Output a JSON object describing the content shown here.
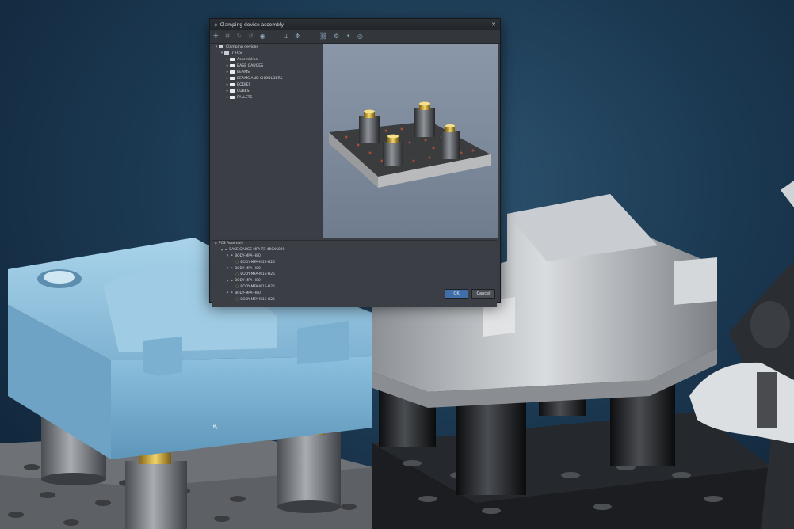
{
  "colors": {
    "background_dark": "#0f2236",
    "cad_part": "#8fc1dc",
    "metal": "#b9bcc0",
    "dialog_bg": "#3a3e44",
    "ok_button": "#3f6ea8"
  },
  "dialog": {
    "title": "Clamping device assembly",
    "close_glyph": "✕",
    "toolbar": [
      {
        "name": "add-icon",
        "glyph": "✚"
      },
      {
        "name": "delete-icon",
        "glyph": "✖"
      },
      {
        "name": "rotate-icon",
        "glyph": "↻"
      },
      {
        "name": "undo-icon",
        "glyph": "↺"
      },
      {
        "name": "view-icon",
        "glyph": "◉"
      },
      {
        "name": "pin-icon",
        "glyph": "⟂"
      },
      {
        "name": "move-icon",
        "glyph": "✥"
      },
      {
        "name": "link-icon",
        "glyph": "⛓"
      },
      {
        "name": "gear-icon",
        "glyph": "⚙"
      },
      {
        "name": "wand-icon",
        "glyph": "✦"
      },
      {
        "name": "eye-icon",
        "glyph": "◎"
      }
    ],
    "tree": {
      "root": "Clamping devices",
      "items": [
        {
          "label": "7 FCS",
          "level": 1,
          "expanded": true
        },
        {
          "label": "Assemblies",
          "level": 2
        },
        {
          "label": "BASE GAUGES",
          "level": 2
        },
        {
          "label": "BEAMS",
          "level": 2
        },
        {
          "label": "BEAMS AND SHOULDERS",
          "level": 2
        },
        {
          "label": "BODIES",
          "level": 2
        },
        {
          "label": "CUBES",
          "level": 2
        },
        {
          "label": "PALLETS",
          "level": 2
        }
      ]
    },
    "assembly_tree": {
      "root": "FCS Assembly",
      "items": [
        {
          "label": "BASE GAUGE MFA TR 400X600S",
          "level": 1,
          "type": "asm"
        },
        {
          "label": "BODY-MFA-H80",
          "level": 2,
          "type": "asm"
        },
        {
          "label": "BODY-MFA-M16-H25",
          "level": 3,
          "type": "part"
        },
        {
          "label": "BODY-MFA-H80",
          "level": 2,
          "type": "asm"
        },
        {
          "label": "BODY-MFA-M16-H25",
          "level": 3,
          "type": "part"
        },
        {
          "label": "BODY-MFA-H80",
          "level": 2,
          "type": "asm"
        },
        {
          "label": "BODY-MFA-M16-H25",
          "level": 3,
          "type": "part"
        },
        {
          "label": "BODY-MFA-H80",
          "level": 2,
          "type": "asm"
        },
        {
          "label": "BODY-MFA-M16-H25",
          "level": 3,
          "type": "part"
        }
      ]
    },
    "ok_label": "OK",
    "cancel_label": "Cancel"
  }
}
